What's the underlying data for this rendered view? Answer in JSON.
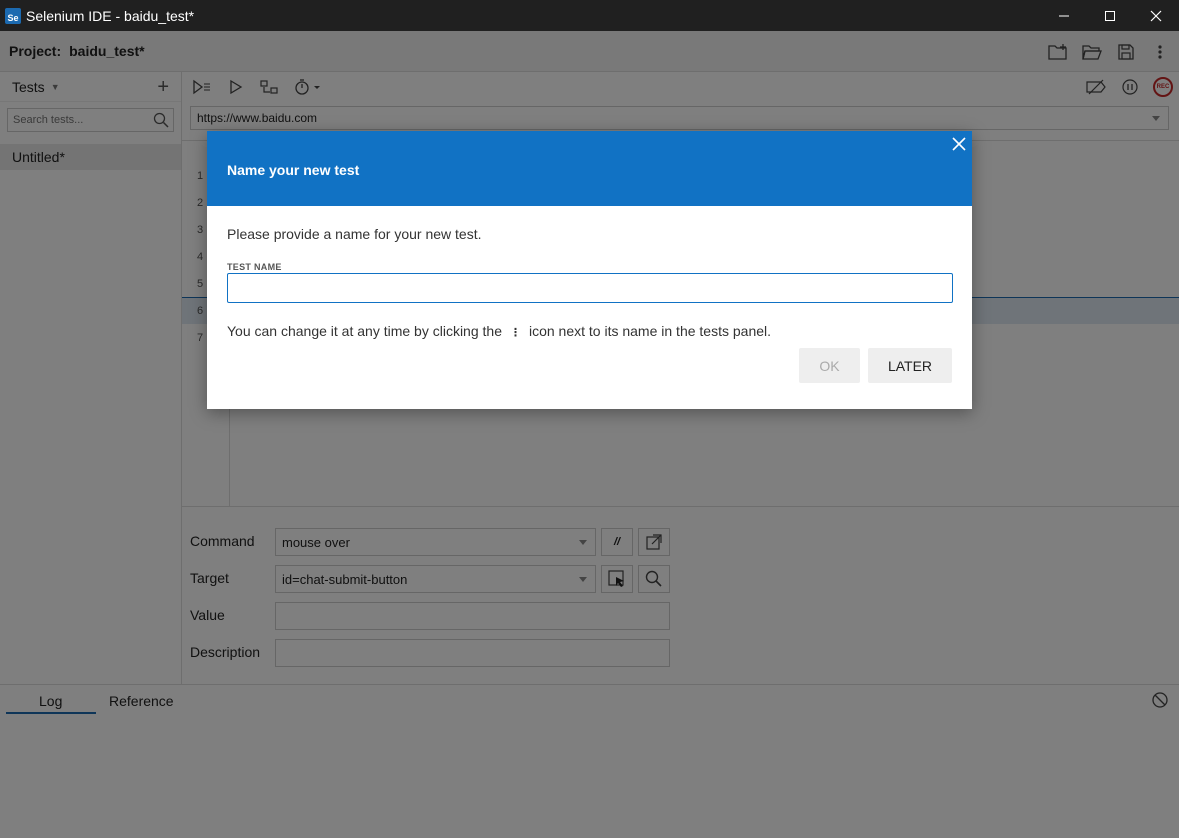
{
  "window": {
    "title": "Selenium IDE - baidu_test*",
    "app_icon_text": "Se"
  },
  "project": {
    "label": "Project:",
    "name": "baidu_test*"
  },
  "sidebar": {
    "title": "Tests",
    "search_placeholder": "Search tests...",
    "items": [
      {
        "label": "Untitled*"
      }
    ]
  },
  "url_bar": {
    "value": "https://www.baidu.com"
  },
  "table": {
    "row_numbers": [
      "1",
      "2",
      "3",
      "4",
      "5",
      "6",
      "7"
    ],
    "selected_row": 6
  },
  "editor": {
    "command_label": "Command",
    "command_value": "mouse over",
    "comment_button": "//",
    "target_label": "Target",
    "target_value": "id=chat-submit-button",
    "value_label": "Value",
    "value_value": "",
    "description_label": "Description",
    "description_value": ""
  },
  "log_panel": {
    "tabs": [
      "Log",
      "Reference"
    ]
  },
  "toolbar": {
    "rec_label": "REC"
  },
  "dialog": {
    "title": "Name your new test",
    "prompt": "Please provide a name for your new test.",
    "field_label": "TEST NAME",
    "field_value": "",
    "hint_before": "You can change it at any time by clicking the",
    "hint_icon": "⋮",
    "hint_after": "icon next to its name in the tests panel.",
    "ok_label": "OK",
    "later_label": "LATER"
  },
  "colors": {
    "accent": "#1172c4",
    "title_bar": "#202020",
    "record": "#c62828"
  }
}
